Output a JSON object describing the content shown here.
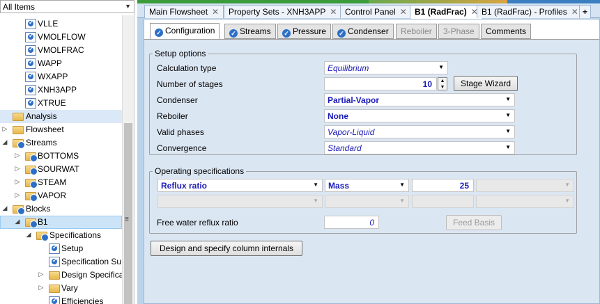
{
  "navigator": {
    "filter": "All Items",
    "items": [
      {
        "label": "VLLE",
        "type": "check"
      },
      {
        "label": "VMOLFLOW",
        "type": "check"
      },
      {
        "label": "VMOLFRAC",
        "type": "check"
      },
      {
        "label": "WAPP",
        "type": "check"
      },
      {
        "label": "WXAPP",
        "type": "check"
      },
      {
        "label": "XNH3APP",
        "type": "check"
      },
      {
        "label": "XTRUE",
        "type": "check"
      },
      {
        "label": "Analysis",
        "type": "folder"
      },
      {
        "label": "Flowsheet",
        "type": "folder"
      },
      {
        "label": "Streams",
        "type": "folder-check"
      },
      {
        "label": "BOTTOMS",
        "type": "folder-check"
      },
      {
        "label": "SOURWAT",
        "type": "folder-check"
      },
      {
        "label": "STEAM",
        "type": "folder-check"
      },
      {
        "label": "VAPOR",
        "type": "folder-check"
      },
      {
        "label": "Blocks",
        "type": "folder-check"
      },
      {
        "label": "B1",
        "type": "folder-check"
      },
      {
        "label": "Specifications",
        "type": "folder-check"
      },
      {
        "label": "Setup",
        "type": "check"
      },
      {
        "label": "Specification Su",
        "type": "check"
      },
      {
        "label": "Design Specifica",
        "type": "folder"
      },
      {
        "label": "Vary",
        "type": "folder"
      },
      {
        "label": "Efficiencies",
        "type": "check"
      }
    ]
  },
  "form_tabs": [
    {
      "label": "Main Flowsheet"
    },
    {
      "label": "Property Sets - XNH3APP"
    },
    {
      "label": "Control Panel"
    },
    {
      "label": "B1 (RadFrac)"
    },
    {
      "label": "B1 (RadFrac) - Profiles"
    },
    {
      "label": "+"
    }
  ],
  "sheet_tabs": [
    "Configuration",
    "Streams",
    "Pressure",
    "Condenser",
    "Reboiler",
    "3-Phase",
    "Comments"
  ],
  "setup": {
    "legend": "Setup options",
    "calc_type_label": "Calculation type",
    "calc_type": "Equilibrium",
    "stages_label": "Number of stages",
    "stages": "10",
    "stage_wizard": "Stage Wizard",
    "condenser_label": "Condenser",
    "condenser": "Partial-Vapor",
    "reboiler_label": "Reboiler",
    "reboiler": "None",
    "phases_label": "Valid phases",
    "phases": "Vapor-Liquid",
    "convergence_label": "Convergence",
    "convergence": "Standard"
  },
  "opspec": {
    "legend": "Operating specifications",
    "spec1": "Reflux ratio",
    "basis1": "Mass",
    "value1": "25",
    "fwrr_label": "Free water reflux ratio",
    "fwrr_value": "0",
    "feed_basis": "Feed Basis"
  },
  "internals_button": "Design and specify column internals",
  "colors": {
    "accent": "#2c6fc9",
    "panel": "#dbe6f3",
    "value_blue": "#1b1bb8"
  }
}
